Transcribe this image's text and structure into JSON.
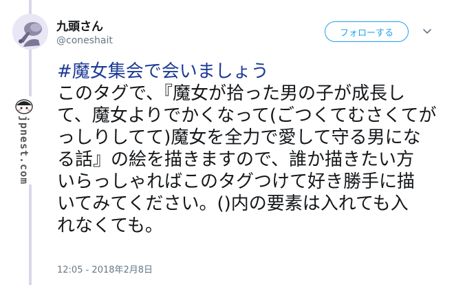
{
  "author": {
    "display_name": "九頭さん",
    "handle": "@coneshait"
  },
  "actions": {
    "follow_label": "フォローする",
    "more_icon": "chevron-down-icon"
  },
  "tweet": {
    "hashtag": "#魔女集会で会いましょう",
    "lines": [
      "このタグで、『魔女が拾った男の子が成長し",
      "て、魔女よりでかくなって(ごつくてむさくてが",
      "っしりしてて)魔女を全力で愛して守る男にな",
      "る話』の絵を描きますので、誰か描きたい方",
      "いらっしゃればこのタグつけて好き勝手に描",
      "いてみてください。()内の要素は入れても入",
      "れなくても。"
    ],
    "timestamp": "12:05 - 2018年2月8日"
  },
  "watermark": {
    "text": "jpnest.com"
  },
  "colors": {
    "hashtag": "#1b3a94",
    "follow_accent": "#1da1f2",
    "secondary_text": "#657786"
  }
}
